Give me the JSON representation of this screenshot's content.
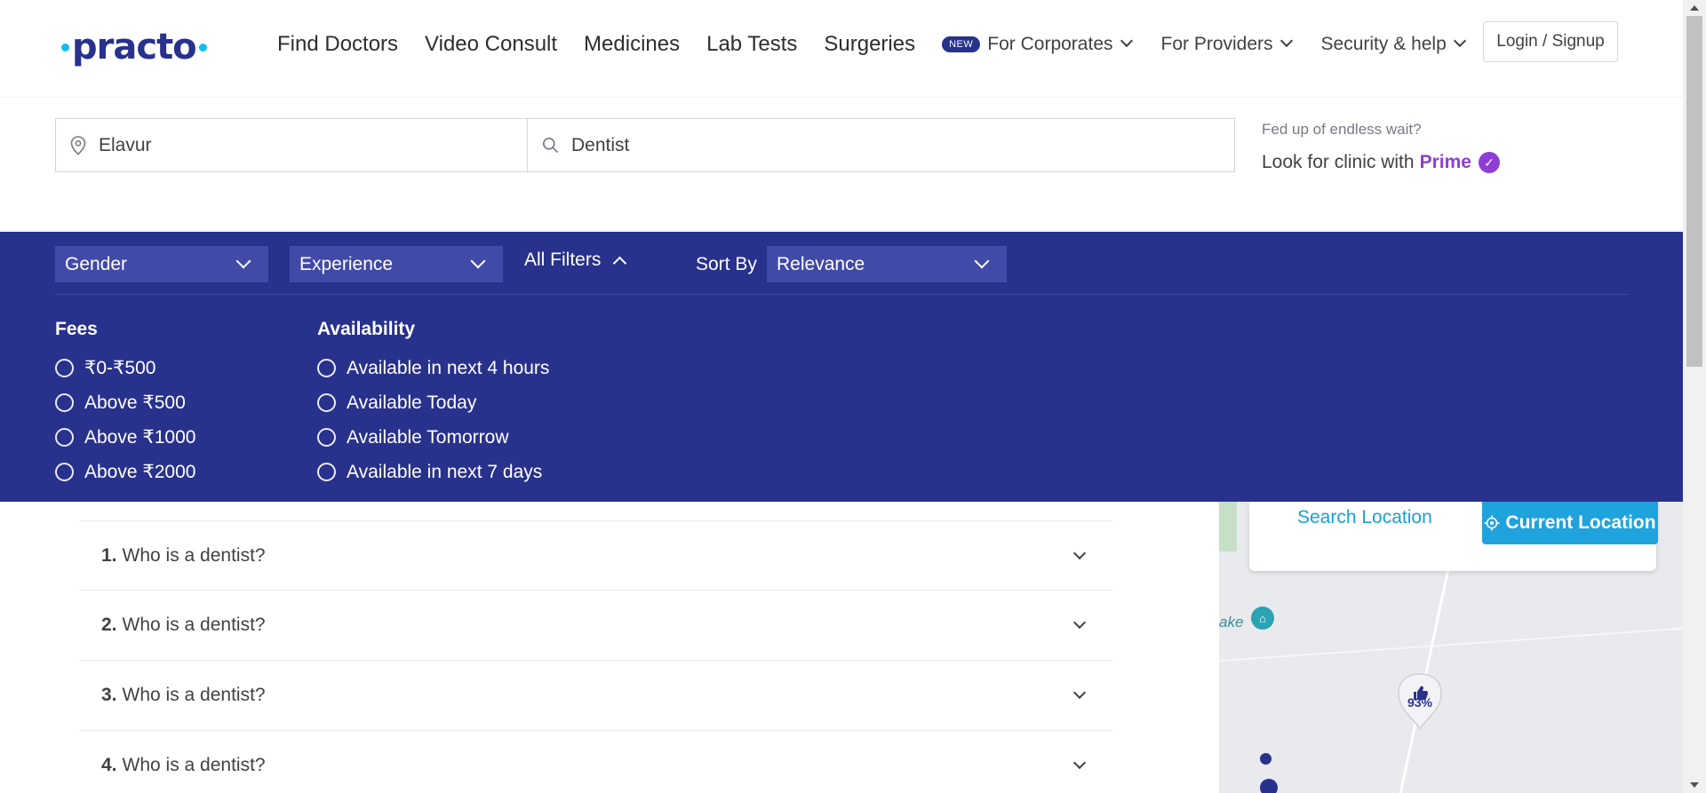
{
  "header": {
    "logo_text": "practo",
    "nav_main": [
      "Find Doctors",
      "Video Consult",
      "Medicines",
      "Lab Tests",
      "Surgeries"
    ],
    "new_badge": "NEW",
    "for_corporates": "For Corporates",
    "for_providers": "For Providers",
    "security_help": "Security & help",
    "login_signup": "Login / Signup"
  },
  "search": {
    "location_value": "Elavur",
    "keyword_value": "Dentist"
  },
  "prime_ad": {
    "line1": "Fed up of endless wait?",
    "line2_prefix": "Look for clinic with",
    "prime": "Prime"
  },
  "filters": {
    "gender": "Gender",
    "experience": "Experience",
    "all_filters": "All Filters",
    "sort_by_label": "Sort By",
    "sort_value": "Relevance",
    "fees": {
      "title": "Fees",
      "options": [
        "₹0-₹500",
        "Above ₹500",
        "Above ₹1000",
        "Above ₹2000"
      ]
    },
    "availability": {
      "title": "Availability",
      "options": [
        "Available in next 4 hours",
        "Available Today",
        "Available Tomorrow",
        "Available in next 7 days"
      ]
    }
  },
  "faq": [
    {
      "num": "1.",
      "question": "Who is a dentist?"
    },
    {
      "num": "2.",
      "question": "Who is a dentist?"
    },
    {
      "num": "3.",
      "question": "Who is a dentist?"
    },
    {
      "num": "4.",
      "question": "Who is a dentist?"
    }
  ],
  "map": {
    "search_location": "Search Location",
    "current_location": "Current Location",
    "pin_percent": "93%",
    "lake_label": "ake"
  },
  "colors": {
    "brand_navy": "#28328c",
    "brand_cyan": "#14bef0",
    "prime_purple": "#8d3ed6"
  }
}
